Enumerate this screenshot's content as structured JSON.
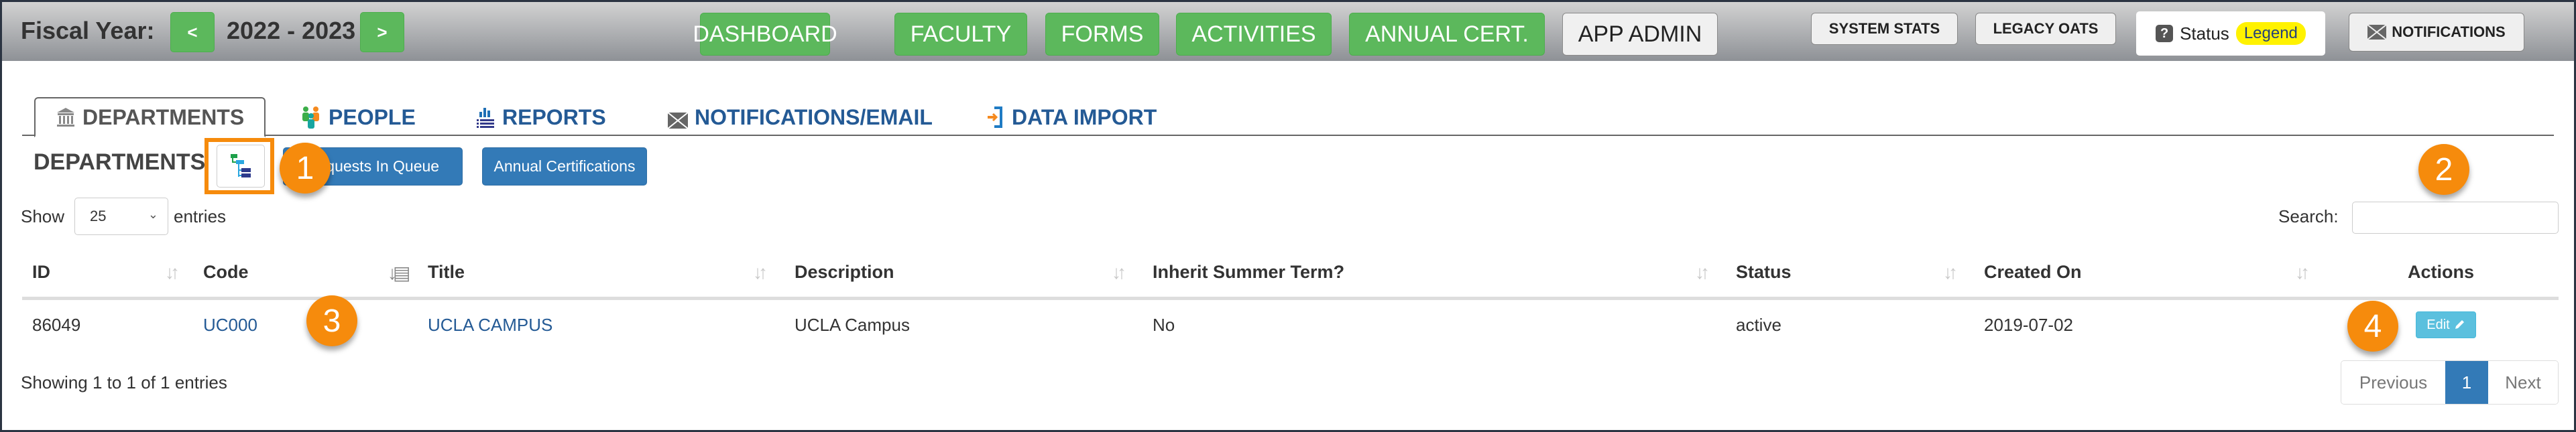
{
  "topbar": {
    "fiscal_year_label": "Fiscal Year:",
    "prev_year_label": "<",
    "fiscal_year_value": "2022 - 2023",
    "next_year_label": ">",
    "nav": [
      {
        "label": "DASHBOARD"
      },
      {
        "label": "FACULTY"
      },
      {
        "label": "FORMS"
      },
      {
        "label": "ACTIVITIES"
      },
      {
        "label": "ANNUAL CERT."
      },
      {
        "label": "APP ADMIN"
      }
    ],
    "system_stats_label": "SYSTEM STATS",
    "legacy_oats_label": "LEGACY OATS",
    "status_label": "Status",
    "legend_label": "Legend",
    "help_icon_glyph": "?",
    "notifications_label": "NOTIFICATIONS"
  },
  "tabs": [
    {
      "label": "DEPARTMENTS",
      "icon": "building-icon",
      "active": true
    },
    {
      "label": "PEOPLE",
      "icon": "people-icon",
      "active": false
    },
    {
      "label": "REPORTS",
      "icon": "chart-list-icon",
      "active": false
    },
    {
      "label": "NOTIFICATIONS/EMAIL",
      "icon": "envelope-icon",
      "active": false
    },
    {
      "label": "DATA IMPORT",
      "icon": "import-icon",
      "active": false
    }
  ],
  "section": {
    "title": "DEPARTMENTS",
    "tree_icon": "hierarchy-tree-icon",
    "requests_in_queue_label": "Requests In Queue",
    "annual_certifications_label": "Annual Certifications"
  },
  "callouts": [
    "1",
    "2",
    "3",
    "4"
  ],
  "length_menu": {
    "show_label": "Show",
    "selected": "25",
    "entries_label": "entries"
  },
  "search": {
    "label": "Search:",
    "value": "",
    "placeholder": ""
  },
  "table": {
    "columns": [
      "ID",
      "Code",
      "Title",
      "Description",
      "Inherit Summer Term?",
      "Status",
      "Created On",
      "Actions"
    ],
    "rows": [
      {
        "id": "86049",
        "code": "UC000",
        "title": "UCLA CAMPUS",
        "description": "UCLA Campus",
        "inherit_summer_term": "No",
        "status": "active",
        "created_on": "2019-07-02",
        "action_label": "Edit"
      }
    ]
  },
  "footer": {
    "info": "Showing 1 to 1 of 1 entries",
    "previous_label": "Previous",
    "current_page": "1",
    "next_label": "Next"
  },
  "colors": {
    "nav_green": "#5cb85c",
    "primary_blue": "#337ab7",
    "info_blue": "#5bc0de",
    "callout_orange": "#f68b0c",
    "legend_yellow": "#fff200",
    "link_blue": "#245a95"
  }
}
